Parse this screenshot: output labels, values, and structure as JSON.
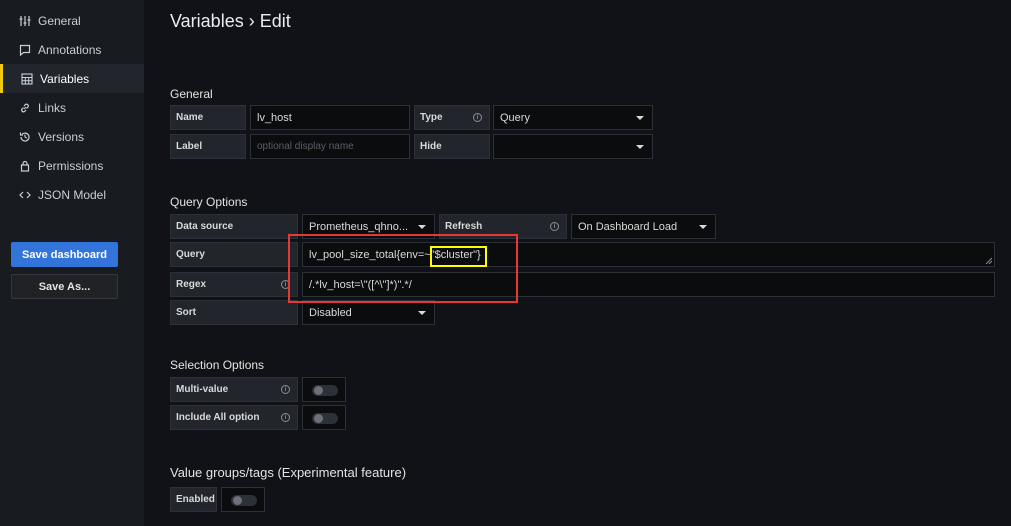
{
  "sidebar": {
    "items": [
      {
        "label": "General",
        "icon": "sliders-icon"
      },
      {
        "label": "Annotations",
        "icon": "comment-icon"
      },
      {
        "label": "Variables",
        "icon": "calculator-icon",
        "active": true
      },
      {
        "label": "Links",
        "icon": "link-icon"
      },
      {
        "label": "Versions",
        "icon": "history-icon"
      },
      {
        "label": "Permissions",
        "icon": "lock-icon"
      },
      {
        "label": "JSON Model",
        "icon": "code-icon"
      }
    ],
    "save_dashboard": "Save dashboard",
    "save_as": "Save As..."
  },
  "page": {
    "title": "Variables › Edit"
  },
  "general": {
    "heading": "General",
    "name_label": "Name",
    "name_value": "lv_host",
    "type_label": "Type",
    "type_value": "Query",
    "label_label": "Label",
    "label_placeholder": "optional display name",
    "hide_label": "Hide",
    "hide_value": ""
  },
  "query_options": {
    "heading": "Query Options",
    "datasource_label": "Data source",
    "datasource_value": "Prometheus_qhno...",
    "refresh_label": "Refresh",
    "refresh_value": "On Dashboard Load",
    "query_label": "Query",
    "query_value_prefix": "lv_pool_size_total{env=~\"",
    "query_value_highlight": "$cluster\"}",
    "regex_label": "Regex",
    "regex_value": "/.*lv_host=\\\"([^\\\"]*)\".*/",
    "sort_label": "Sort",
    "sort_value": "Disabled"
  },
  "selection_options": {
    "heading": "Selection Options",
    "multi_value_label": "Multi-value",
    "multi_value_on": false,
    "include_all_label": "Include All option",
    "include_all_on": false
  },
  "value_groups": {
    "heading": "Value groups/tags (Experimental feature)",
    "enabled_label": "Enabled",
    "enabled_on": false
  },
  "colors": {
    "accent": "#3274d9",
    "active_indicator": "#f2cc0c",
    "annotation_red": "#e53936",
    "annotation_yellow": "#ffff00"
  }
}
